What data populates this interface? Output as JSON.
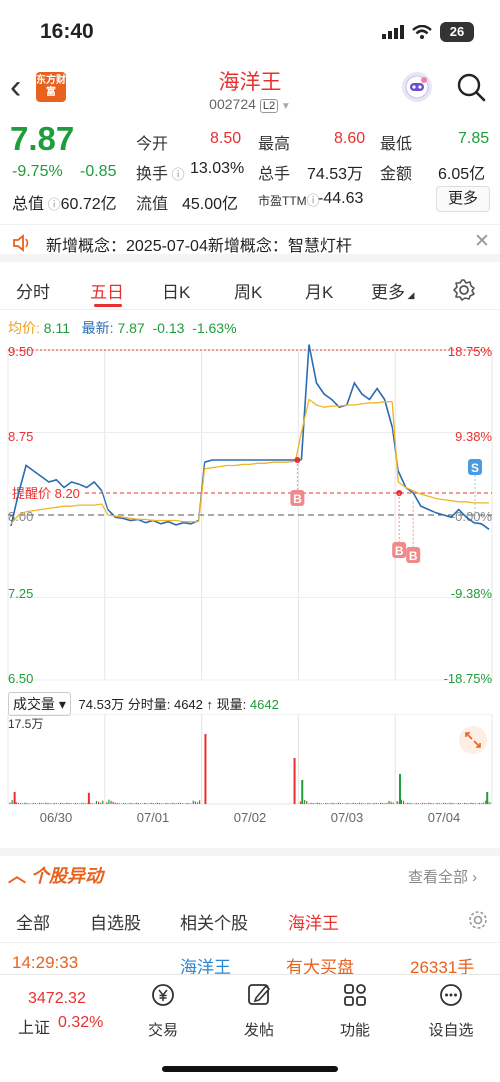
{
  "status": {
    "time": "16:40",
    "battery": "26"
  },
  "header": {
    "logo_text": "东方财富",
    "stock_name": "海洋王",
    "stock_code": "002724",
    "level": "L2"
  },
  "quote": {
    "price": "7.87",
    "change_pct": "-9.75%",
    "change_abs": "-0.85",
    "market_cap_label": "总值",
    "market_cap": "60.72亿",
    "open_label": "今开",
    "open": "8.50",
    "high_label": "最高",
    "high": "8.60",
    "low_label": "最低",
    "low": "7.85",
    "turnover_label": "换手",
    "turnover": "13.03%",
    "volume_label": "总手",
    "volume": "74.53万",
    "amount_label": "金额",
    "amount": "6.05亿",
    "float_label": "流值",
    "float_value": "45.00亿",
    "pe_label": "市盈TTM",
    "pe": "-44.63",
    "more_label": "更多"
  },
  "news": {
    "text": "新增概念：2025-07-04新增概念：智慧灯杆"
  },
  "tabs": [
    {
      "label": "分时"
    },
    {
      "label": "五日"
    },
    {
      "label": "日K"
    },
    {
      "label": "周K"
    },
    {
      "label": "月K"
    },
    {
      "label": "更多"
    }
  ],
  "active_tab": "五日",
  "avg_row": {
    "avg_label": "均价:",
    "avg": "8.11",
    "latest_label": "最新:",
    "latest": "7.87",
    "chg": "-0.13",
    "pct": "-1.63%"
  },
  "chart_data": {
    "type": "line",
    "title": "",
    "price_ticks_left": [
      "9.50",
      "8.75",
      "8.00",
      "7.25",
      "6.50"
    ],
    "pct_ticks_right": [
      "18.75%",
      "9.38%",
      "-0.00%",
      "-9.38%",
      "-18.75%"
    ],
    "ylim": [
      6.5,
      9.5
    ],
    "reminder_label": "提醒价 8.20",
    "reminder_price": 8.2,
    "days": [
      "06/30",
      "07/01",
      "07/02",
      "07/03",
      "07/04"
    ],
    "series": [
      {
        "name": "价格",
        "color": "#2b6cb0",
        "values": [
          [
            7.9,
            8.2,
            8.45,
            8.4,
            8.35,
            8.3,
            8.32,
            8.25,
            8.3,
            8.28,
            8.25,
            8.3,
            8.22
          ],
          [
            8.05,
            7.98,
            7.97,
            7.95,
            7.96,
            7.93,
            7.95,
            7.92,
            7.94,
            7.91,
            7.93,
            7.92,
            7.95
          ],
          [
            8.48,
            8.5,
            8.5,
            8.5,
            8.5,
            8.5,
            8.5,
            8.5,
            8.5,
            8.5,
            8.5,
            8.5,
            8.5
          ],
          [
            8.5,
            9.55,
            9.2,
            9.1,
            9.05,
            8.98,
            9.0,
            9.2,
            9.1,
            9.05,
            9.15,
            9.05,
            8.8
          ],
          [
            8.4,
            8.25,
            8.2,
            8.08,
            8.05,
            8.02,
            8.0,
            7.98,
            8.05,
            7.98,
            7.93,
            7.92,
            7.87
          ]
        ]
      },
      {
        "name": "均价",
        "color": "#f0b429",
        "values": [
          [
            7.92,
            8.0,
            8.03,
            8.04,
            8.05,
            8.06,
            8.07,
            8.08,
            8.08,
            8.09,
            8.09,
            8.09,
            8.1
          ],
          [
            8.0,
            7.99,
            7.98,
            7.97,
            7.96,
            7.96,
            7.95,
            7.95,
            7.95,
            7.95,
            7.94,
            7.94,
            7.94
          ],
          [
            8.42,
            8.43,
            8.44,
            8.45,
            8.45,
            8.46,
            8.46,
            8.47,
            8.47,
            8.48,
            8.48,
            8.48,
            8.49
          ],
          [
            8.75,
            9.05,
            9.0,
            8.98,
            8.99,
            8.99,
            9.0,
            9.0,
            9.01,
            9.02,
            9.02,
            9.03,
            9.03
          ],
          [
            8.3,
            8.25,
            8.22,
            8.19,
            8.17,
            8.15,
            8.14,
            8.13,
            8.12,
            8.12,
            8.11,
            8.11,
            8.11
          ]
        ]
      }
    ],
    "volume_label": "成交量",
    "volume_total": "74.53万",
    "volume_minute_label": "分时量:",
    "volume_minute": "4642",
    "volume_now_label": "现量:",
    "volume_now": "4642",
    "volume_max_label": "17.5万",
    "volume_spikes": [
      {
        "day": 0,
        "pos": 0.05,
        "v": 30000
      },
      {
        "day": 0,
        "pos": 0.85,
        "v": 28000
      },
      {
        "day": 2,
        "pos": 0.02,
        "v": 175000
      },
      {
        "day": 2,
        "pos": 0.98,
        "v": 115000
      },
      {
        "day": 3,
        "pos": 0.02,
        "v": 60000
      },
      {
        "day": 4,
        "pos": 0.03,
        "v": 75000
      },
      {
        "day": 4,
        "pos": 0.97,
        "v": 30000
      }
    ]
  },
  "activity": {
    "title": "个股异动",
    "view_all": "查看全部",
    "subtabs": [
      {
        "label": "全部"
      },
      {
        "label": "自选股"
      },
      {
        "label": "相关个股"
      },
      {
        "label": "海洋王"
      }
    ],
    "active_subtab": "海洋王",
    "rows": [
      {
        "time": "14:29:33",
        "name": "海洋王",
        "type": "有大买盘",
        "volume": "26331手"
      }
    ]
  },
  "bottom": {
    "index_value": "3472.32",
    "index_name": "上证",
    "index_pct": "0.32%",
    "nav": [
      {
        "label": "交易",
        "icon": "trade-icon"
      },
      {
        "label": "发帖",
        "icon": "post-icon"
      },
      {
        "label": "功能",
        "icon": "function-icon"
      },
      {
        "label": "设自选",
        "icon": "add-watch-icon"
      }
    ]
  },
  "colors": {
    "up": "#e93030",
    "down": "#1f9d3b",
    "accent": "#e8621e"
  }
}
